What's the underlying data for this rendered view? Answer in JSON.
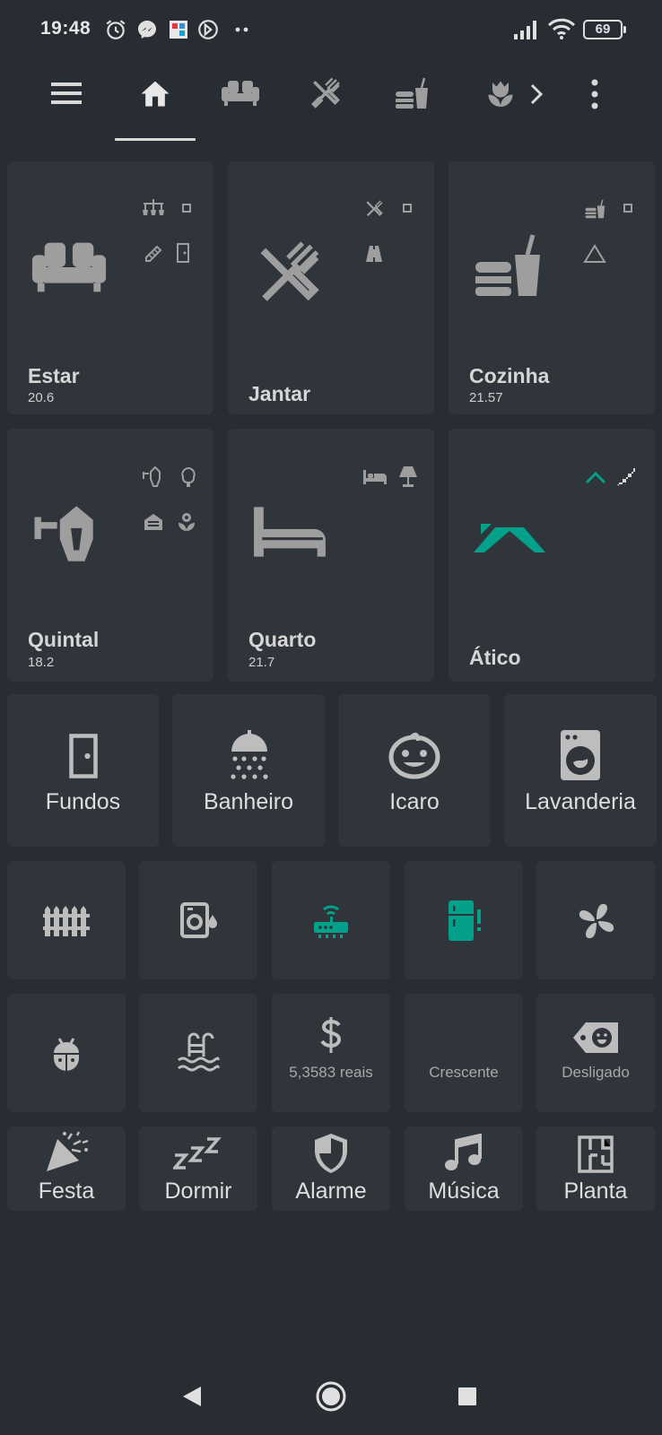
{
  "status_bar": {
    "time": "19:48",
    "left_icons": [
      "alarm-clock-icon",
      "messenger-icon",
      "app-notification-icon",
      "screen-record-icon",
      "more-notifications-icon"
    ],
    "right_icons": [
      "signal-icon",
      "wifi-icon",
      "battery-icon"
    ],
    "battery": "69"
  },
  "top_nav": {
    "tabs": [
      "menu-icon",
      "home-icon",
      "sofa-icon",
      "utensils-icon",
      "food-drink-icon",
      "flower-icon"
    ],
    "active_tab": "home-icon",
    "more_tabs_icon": "chevron-right-icon",
    "overflow_icon": "more-vertical-icon"
  },
  "rooms_large": [
    {
      "name": "Estar",
      "temp": "20.6",
      "icon": "sofa-icon",
      "badges": [
        "chandelier-icon",
        "small-square-icon",
        "pencil-icon",
        "door-icon"
      ]
    },
    {
      "name": "Jantar",
      "temp": "",
      "icon": "utensils-icon",
      "badges": [
        "utensils-icon",
        "small-square-icon",
        "road-icon"
      ]
    },
    {
      "name": "Cozinha",
      "temp": "21.57",
      "icon": "food-drink-icon",
      "badges": [
        "food-drink-icon",
        "small-square-icon",
        "triangle-outline-icon"
      ]
    },
    {
      "name": "Quintal",
      "temp": "18.2",
      "icon": "outdoor-lamp-icon",
      "badges": [
        "outdoor-lamp-icon",
        "tree-icon",
        "garage-icon",
        "flower-icon"
      ]
    },
    {
      "name": "Quarto",
      "temp": "21.7",
      "icon": "bed-icon",
      "badges": [
        "bed-icon",
        "lamp-icon"
      ]
    },
    {
      "name": "Ático",
      "temp": "",
      "icon": "roof-icon",
      "badges": [
        "roof-icon",
        "stairs-icon"
      ]
    }
  ],
  "rooms_medium": [
    {
      "name": "Fundos",
      "icon": "door-icon"
    },
    {
      "name": "Banheiro",
      "icon": "shower-icon"
    },
    {
      "name": "Icaro",
      "icon": "baby-face-icon"
    },
    {
      "name": "Lavanderia",
      "icon": "washing-machine-icon"
    }
  ],
  "devices": [
    {
      "icon": "fence-icon"
    },
    {
      "icon": "water-heater-icon"
    },
    {
      "icon": "router-wireless-icon"
    },
    {
      "icon": "fridge-alert-icon"
    },
    {
      "icon": "fan-icon"
    }
  ],
  "sensors": [
    {
      "icon": "bug-icon",
      "value": ""
    },
    {
      "icon": "pool-icon",
      "value": ""
    },
    {
      "icon": "dollar-icon",
      "value": "5,3583 reais"
    },
    {
      "icon": "moon-crescent-icon",
      "value": "Crescente"
    },
    {
      "icon": "tag-face-icon",
      "value": "Desligado"
    }
  ],
  "scenes": [
    {
      "name": "Festa",
      "icon": "party-popper-icon"
    },
    {
      "name": "Dormir",
      "icon": "sleep-icon"
    },
    {
      "name": "Alarme",
      "icon": "shield-icon"
    },
    {
      "name": "Música",
      "icon": "music-note-icon"
    },
    {
      "name": "Planta",
      "icon": "floor-plan-icon"
    }
  ],
  "nav_bar": {
    "buttons": [
      "back-icon",
      "home-circle-icon",
      "recents-icon"
    ]
  },
  "colors": {
    "background": "#282c33",
    "card": "#30343b",
    "icon": "#9e9e9e",
    "accent": "#03a08a"
  }
}
